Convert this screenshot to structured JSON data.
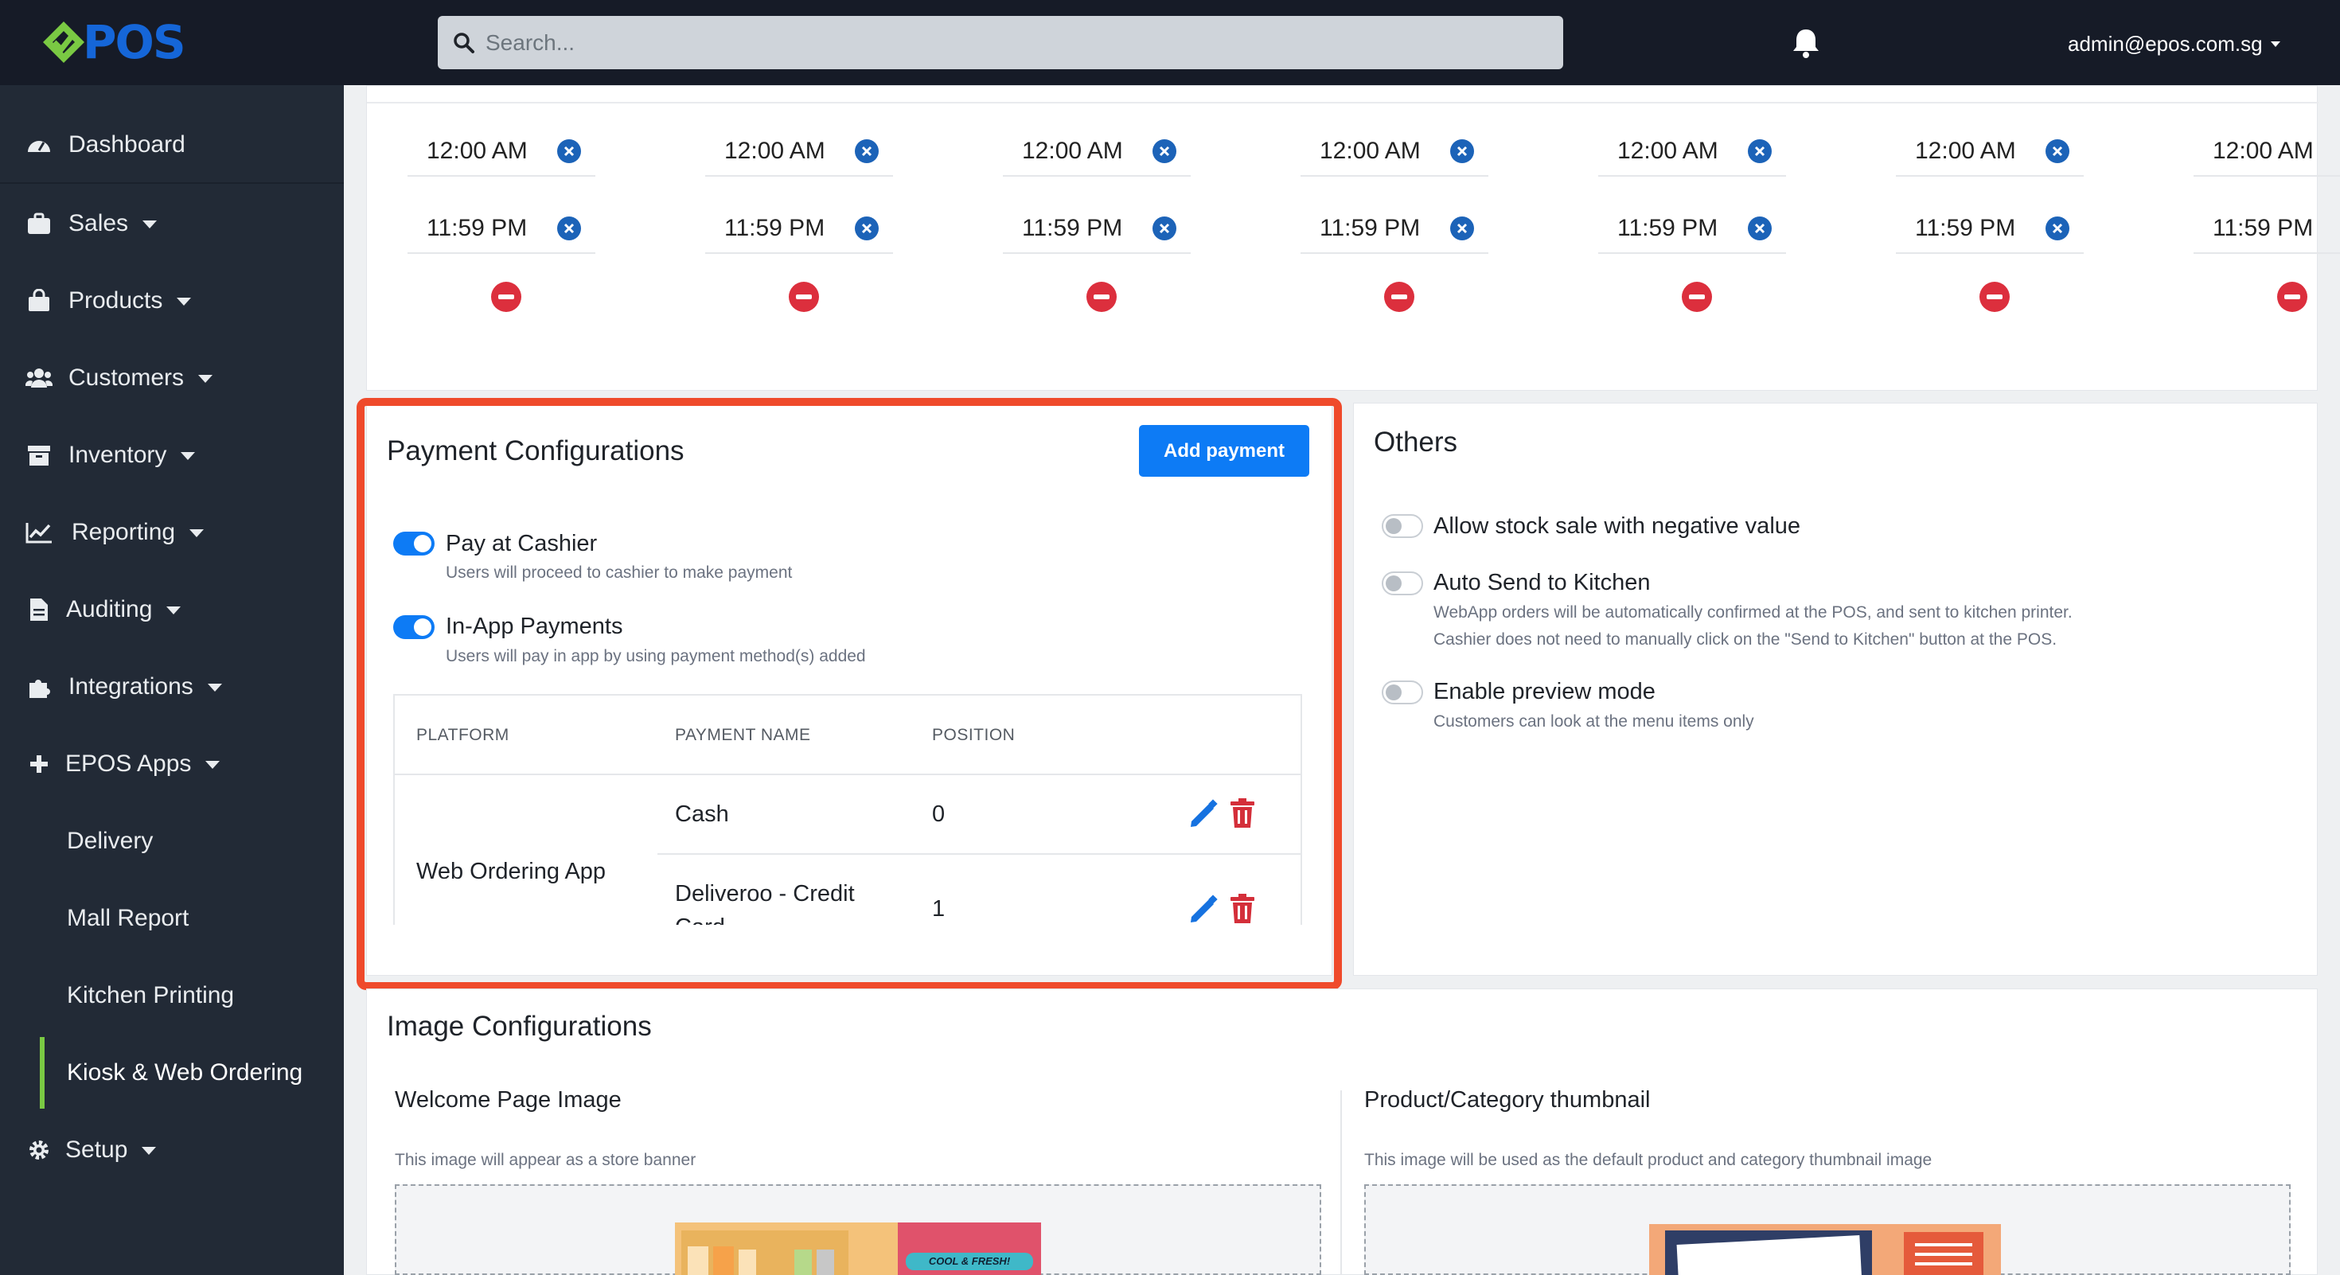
{
  "header": {
    "brand": "POS",
    "search_placeholder": "Search...",
    "user": "admin@epos.com.sg",
    "icons": [
      "search-icon",
      "bell-icon",
      "caret-down-icon"
    ]
  },
  "sidebar": {
    "items": [
      {
        "label": "Dashboard",
        "icon": "dashboard-icon"
      },
      {
        "label": "Sales",
        "icon": "briefcase-icon"
      },
      {
        "label": "Products",
        "icon": "shopping-bag-icon"
      },
      {
        "label": "Customers",
        "icon": "users-icon"
      },
      {
        "label": "Inventory",
        "icon": "archive-icon"
      },
      {
        "label": "Reporting",
        "icon": "chart-line-icon"
      },
      {
        "label": "Auditing",
        "icon": "file-icon"
      },
      {
        "label": "Integrations",
        "icon": "puzzle-icon"
      },
      {
        "label": "EPOS Apps",
        "icon": "plus-icon"
      },
      {
        "label": "Delivery"
      },
      {
        "label": "Mall Report"
      },
      {
        "label": "Kitchen Printing"
      },
      {
        "label": "Kiosk & Web Ordering",
        "active": true
      },
      {
        "label": "Setup",
        "icon": "gear-icon"
      }
    ]
  },
  "schedule": {
    "start": "12:00 AM",
    "end": "11:59 PM",
    "columns": 7
  },
  "payment": {
    "title": "Payment Configurations",
    "add_button": "Add payment",
    "options": [
      {
        "label": "Pay at Cashier",
        "help": "Users will proceed to cashier to make payment",
        "enabled": true
      },
      {
        "label": "In-App Payments",
        "help": "Users will pay in app by using payment method(s) added",
        "enabled": true
      }
    ],
    "table": {
      "headers": [
        "PLATFORM",
        "PAYMENT NAME",
        "POSITION"
      ],
      "platform": "Web Ordering App",
      "rows": [
        {
          "name": "Cash",
          "position": "0"
        },
        {
          "name_line1": "Deliveroo - Credit",
          "name_line2": "Card",
          "position": "1"
        }
      ]
    }
  },
  "others": {
    "title": "Others",
    "options": [
      {
        "label": "Allow stock sale with negative value",
        "enabled": false
      },
      {
        "label": "Auto Send to Kitchen",
        "help_line1": "WebApp orders will be automatically confirmed at the POS, and sent to kitchen printer.",
        "help_line2": "Cashier does not need to manually click on the \"Send to Kitchen\" button at the POS.",
        "enabled": false
      },
      {
        "label": "Enable preview mode",
        "help": "Customers can look at the menu items only",
        "enabled": false
      }
    ]
  },
  "images": {
    "title": "Image Configurations",
    "welcome": {
      "label": "Welcome Page Image",
      "help": "This image will appear as a store banner",
      "banner_text": "COOL & FRESH!"
    },
    "thumbnail": {
      "label": "Product/Category thumbnail",
      "help": "This image will be used as the default product and category thumbnail image"
    }
  },
  "colors": {
    "topbar": "#161b27",
    "sidebar": "#222a36",
    "accent": "#0d7bf5",
    "danger": "#dc2f3d",
    "highlight": "#ef4a2b",
    "active_indicator": "#7ac943"
  }
}
